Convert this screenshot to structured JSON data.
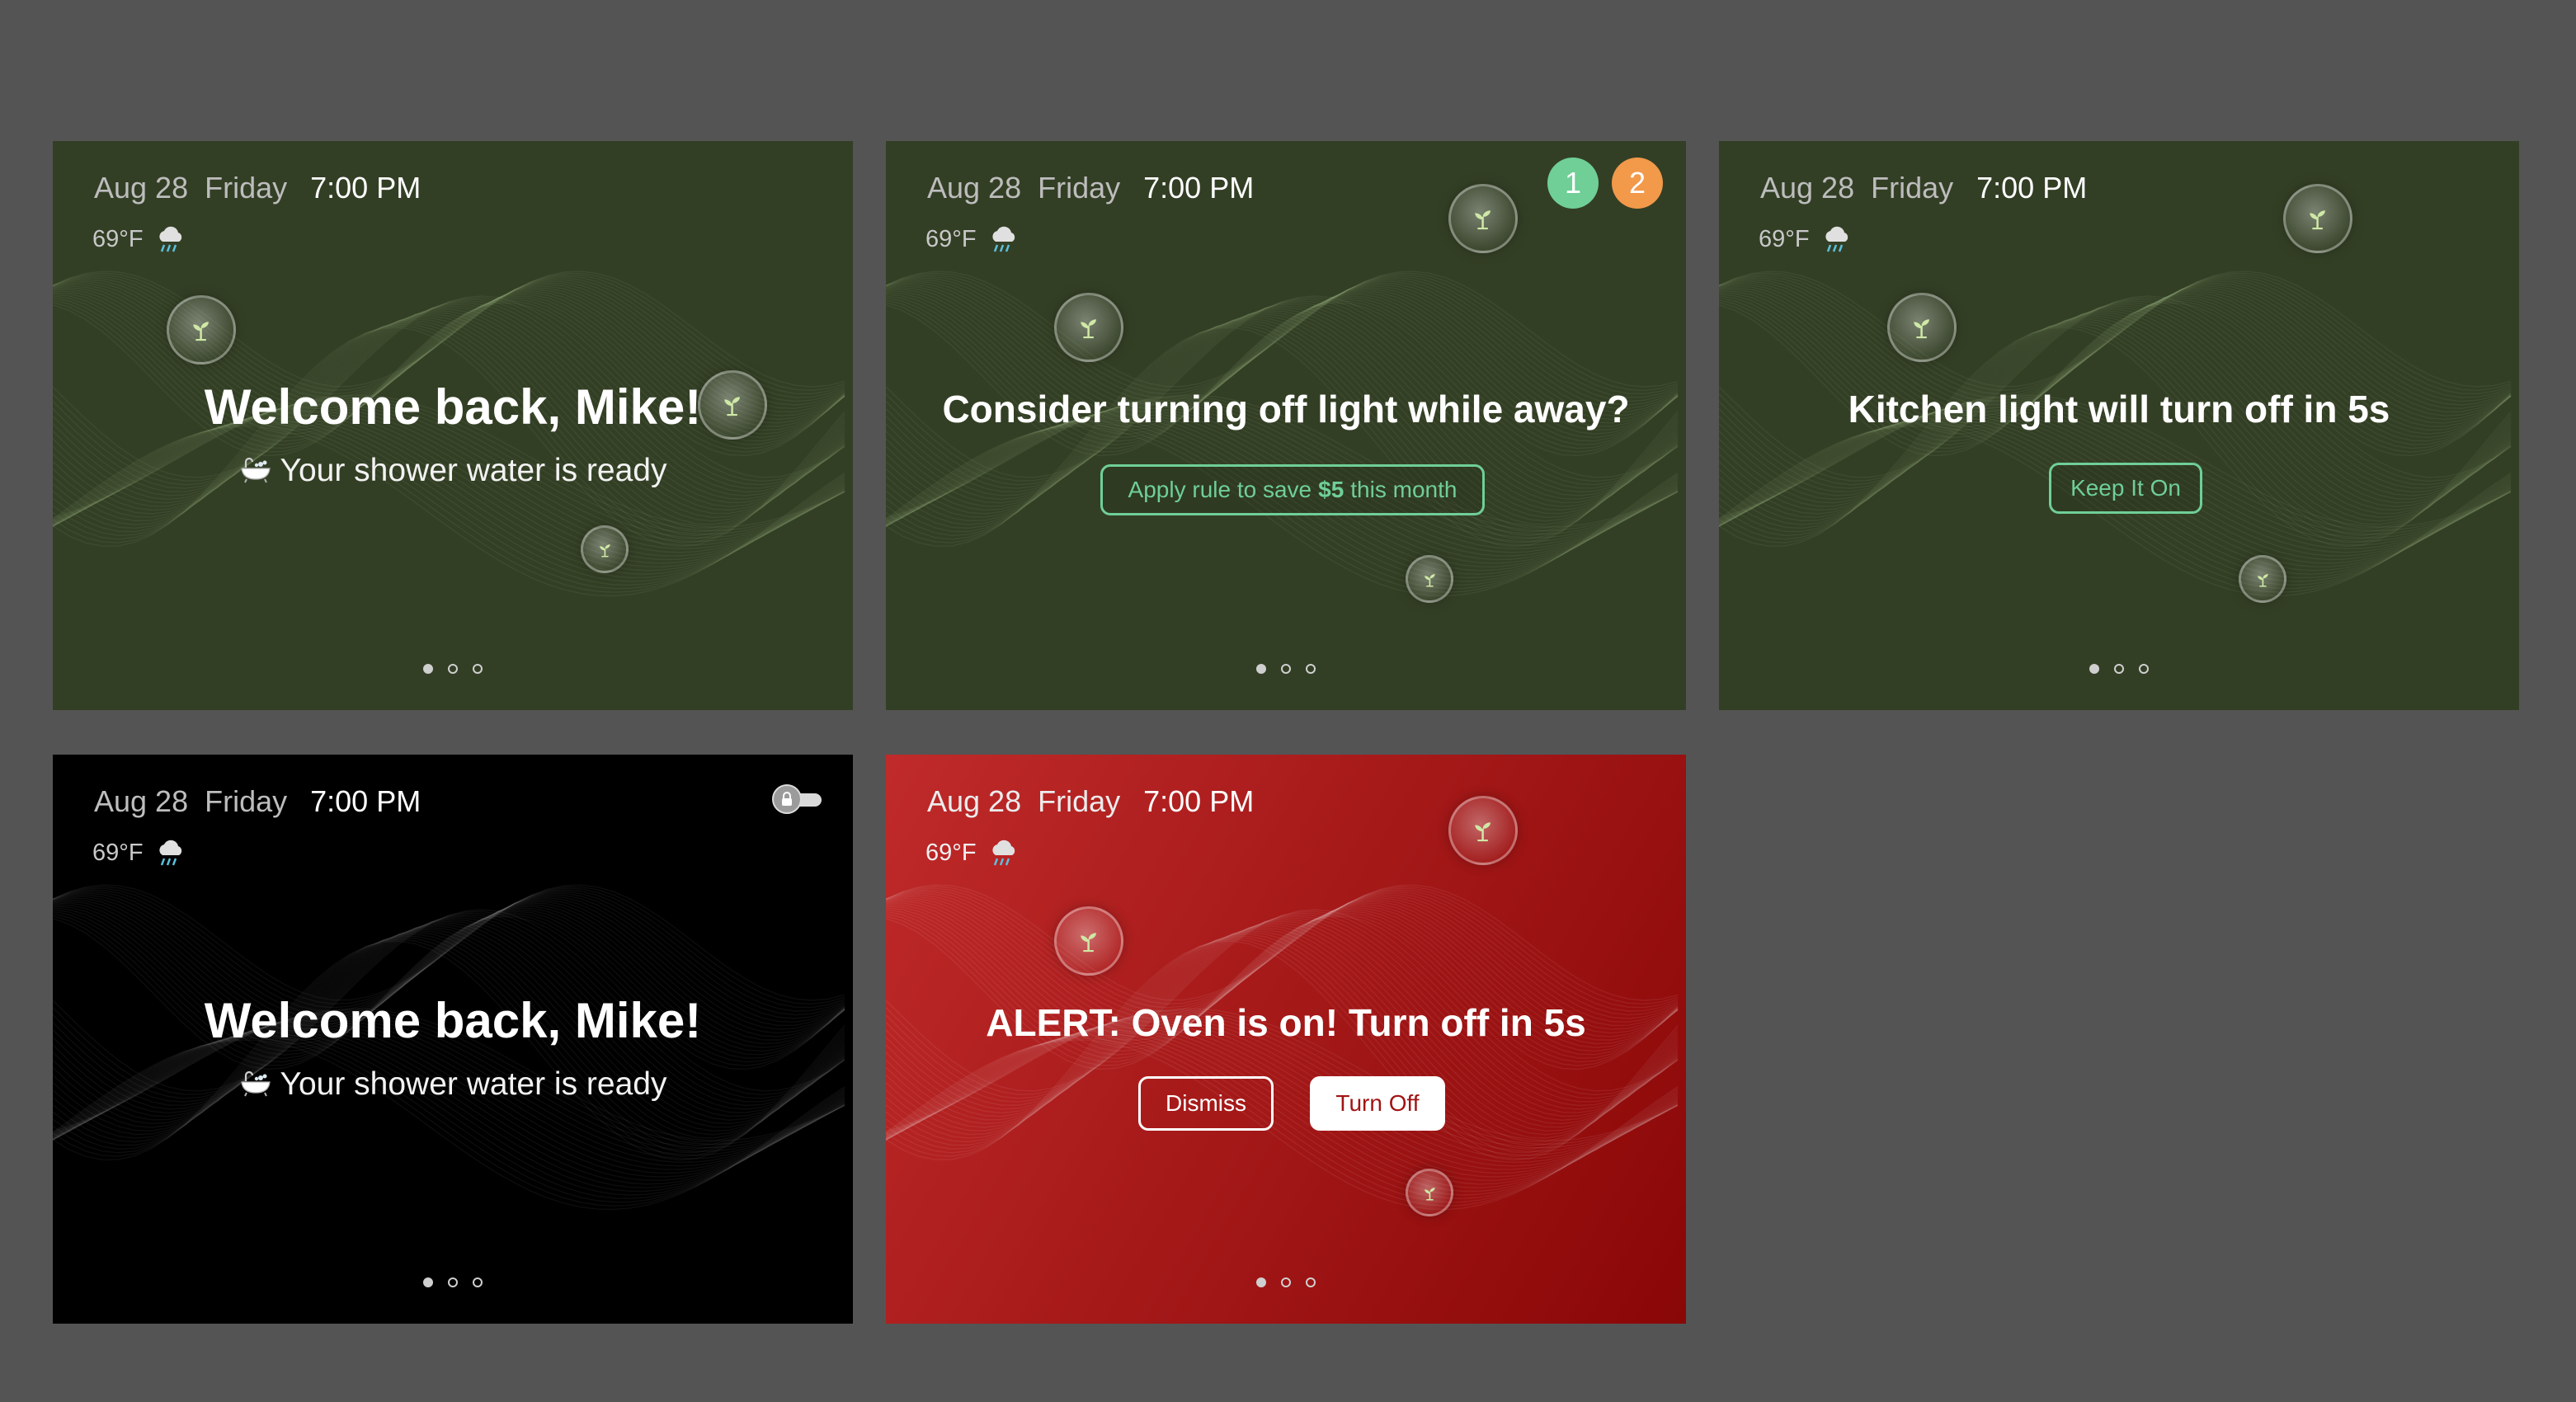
{
  "colors": {
    "background": "#545454",
    "green_card": "#333f25",
    "black_card": "#000000",
    "red_card": "#a41818",
    "accent_green": "#6fcf97",
    "badge_green": "#6fcf97",
    "badge_orange": "#f2994a"
  },
  "cards": [
    {
      "header": {
        "date": "Aug 28",
        "day": "Friday",
        "time": "7:00 PM"
      },
      "weather": {
        "temp": "69°F",
        "icon": "rain-cloud-icon"
      },
      "title": "Welcome back, Mike!",
      "subtitle": "Your shower water is ready",
      "subtitle_icon": "bathtub-icon",
      "pagination": {
        "pages": 3,
        "active": 1
      }
    },
    {
      "header": {
        "date": "Aug 28",
        "day": "Friday",
        "time": "7:00 PM"
      },
      "weather": {
        "temp": "69°F",
        "icon": "rain-cloud-icon"
      },
      "badges": [
        "1",
        "2"
      ],
      "title": "Consider turning off light while away?",
      "button": {
        "prefix": "Apply rule to save",
        "amount": "$5",
        "suffix": "this month"
      },
      "pagination": {
        "pages": 3,
        "active": 1
      }
    },
    {
      "header": {
        "date": "Aug 28",
        "day": "Friday",
        "time": "7:00 PM"
      },
      "weather": {
        "temp": "69°F",
        "icon": "rain-cloud-icon"
      },
      "title": "Kitchen light will turn off in 5s",
      "button": {
        "label": "Keep It On"
      },
      "pagination": {
        "pages": 3,
        "active": 1
      }
    },
    {
      "header": {
        "date": "Aug 28",
        "day": "Friday",
        "time": "7:00 PM"
      },
      "weather": {
        "temp": "69°F",
        "icon": "rain-cloud-icon"
      },
      "toggle_icon": "lock-toggle-icon",
      "title": "Welcome back, Mike!",
      "subtitle": "Your shower water is ready",
      "subtitle_icon": "bathtub-icon",
      "pagination": {
        "pages": 3,
        "active": 1
      }
    },
    {
      "header": {
        "date": "Aug 28",
        "day": "Friday",
        "time": "7:00 PM"
      },
      "weather": {
        "temp": "69°F",
        "icon": "rain-cloud-icon"
      },
      "title": "ALERT: Oven is on! Turn off in 5s",
      "buttons": {
        "dismiss": "Dismiss",
        "turn_off": "Turn Off"
      },
      "pagination": {
        "pages": 3,
        "active": 1
      }
    }
  ]
}
